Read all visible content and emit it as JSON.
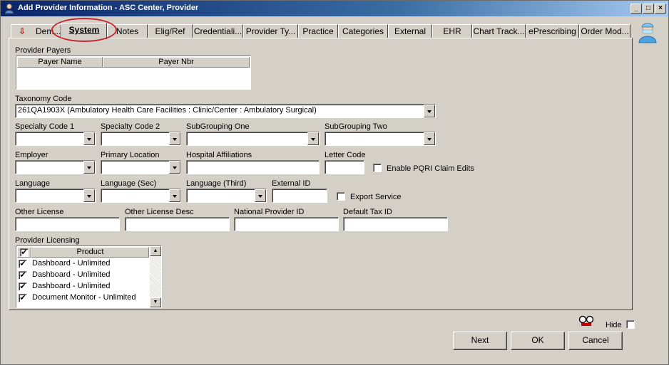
{
  "window": {
    "title": "Add Provider Information - ASC Center, Provider"
  },
  "tabs": [
    {
      "label": "Dem..."
    },
    {
      "label": "System"
    },
    {
      "label": "Notes"
    },
    {
      "label": "Elig/Ref"
    },
    {
      "label": "Credentiali..."
    },
    {
      "label": "Provider Ty..."
    },
    {
      "label": "Practice"
    },
    {
      "label": "Categories"
    },
    {
      "label": "External"
    },
    {
      "label": "EHR"
    },
    {
      "label": "Chart Track..."
    },
    {
      "label": "ePrescribing"
    },
    {
      "label": "Order Mod..."
    }
  ],
  "provider_payers": {
    "label": "Provider Payers",
    "columns": [
      "Payer Name",
      "Payer Nbr"
    ]
  },
  "taxonomy": {
    "label": "Taxonomy Code",
    "value": "261QA1903X (Ambulatory Health Care Facilities : Clinic/Center : Ambulatory Surgical)"
  },
  "labels": {
    "specialty1": "Specialty Code 1",
    "specialty2": "Specialty Code 2",
    "subgroup1": "SubGrouping One",
    "subgroup2": "SubGrouping Two",
    "employer": "Employer",
    "primary_location": "Primary Location",
    "hospital_affiliations": "Hospital Affiliations",
    "letter_code": "Letter Code",
    "enable_pqri": "Enable PQRI Claim Edits",
    "language": "Language",
    "language_sec": "Language (Sec)",
    "language_third": "Language (Third)",
    "external_id": "External ID",
    "export_service": "Export Service",
    "other_license": "Other License",
    "other_license_desc": "Other License Desc",
    "npi": "National Provider ID",
    "default_tax_id": "Default Tax ID"
  },
  "licensing": {
    "label": "Provider Licensing",
    "column": "Product",
    "rows": [
      {
        "product": "Dashboard - Unlimited",
        "checked": true
      },
      {
        "product": "Dashboard - Unlimited",
        "checked": true
      },
      {
        "product": "Dashboard - Unlimited",
        "checked": true
      },
      {
        "product": "Document Monitor - Unlimited",
        "checked": true
      }
    ]
  },
  "check_glyph": "✔",
  "footer": {
    "hide_label": "Hide",
    "next_label": "Next",
    "ok_label": "OK",
    "cancel_label": "Cancel"
  }
}
